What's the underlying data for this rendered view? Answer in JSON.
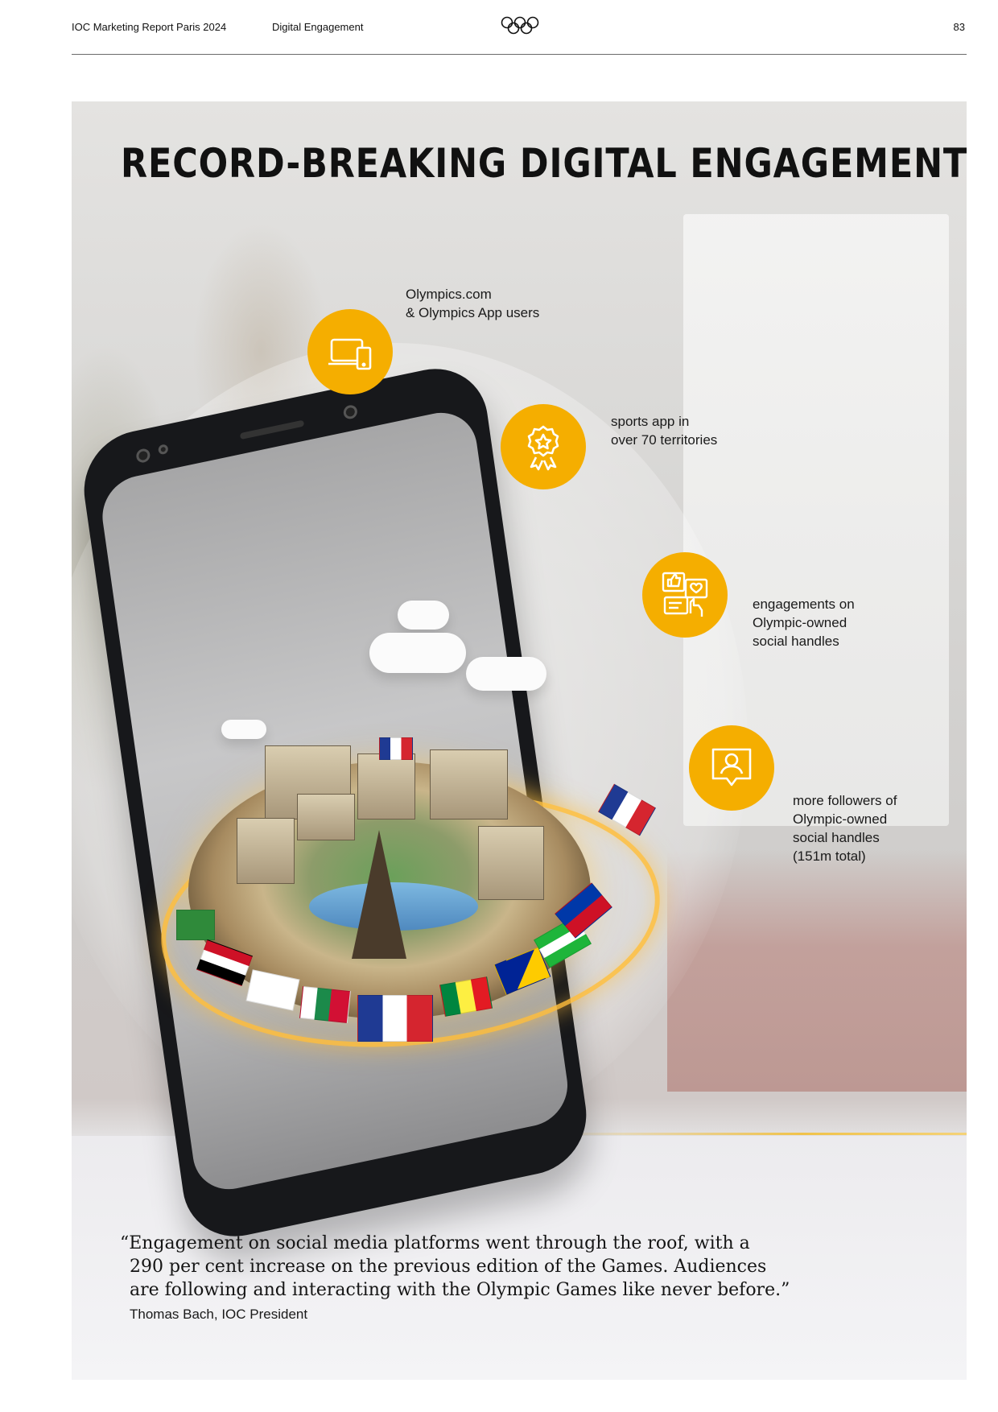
{
  "header": {
    "report_title": "IOC Marketing Report Paris 2024",
    "section": "Digital Engagement",
    "page_number": "83"
  },
  "headline": "RECORD-BREAKING DIGITAL ENGAGEMENT",
  "stats": [
    {
      "icon": "devices-icon",
      "lines": [
        "Olympics.com",
        "& Olympics App users"
      ]
    },
    {
      "icon": "award-ribbon-icon",
      "lines": [
        "sports app in",
        "over 70 territories"
      ]
    },
    {
      "icon": "social-reactions-icon",
      "lines": [
        "engagements on",
        "Olympic-owned",
        "social handles"
      ]
    },
    {
      "icon": "user-profile-icon",
      "lines": [
        "more followers of",
        "Olympic-owned",
        "social handles",
        "(151m total)"
      ]
    }
  ],
  "quote": {
    "lines": [
      "“Engagement on social media platforms went through the roof, with a",
      "290 per cent increase on the previous edition of the Games. Audiences",
      "are following and interacting with the Olympic Games like never before.”"
    ],
    "attribution": "Thomas Bach, IOC President"
  },
  "colors": {
    "accent": "#f5ae00",
    "rule": "#6b6b6b",
    "text": "#111111"
  }
}
